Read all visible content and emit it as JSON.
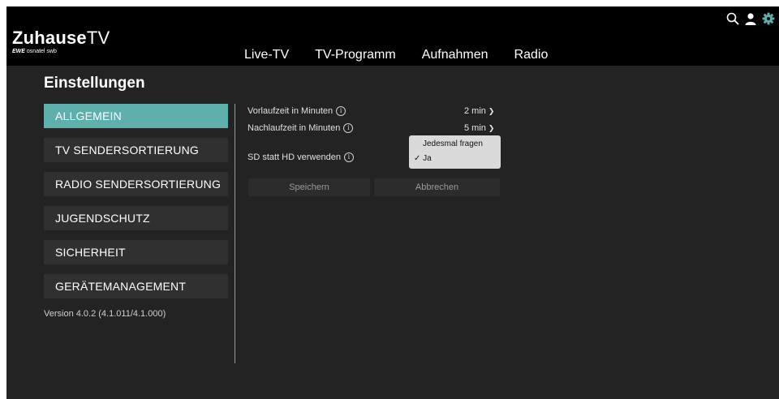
{
  "brand": {
    "title_bold": "Zuhause",
    "title_thin": "TV",
    "sub_ewe": "EWE",
    "sub_rest": "osnatel swb"
  },
  "nav": {
    "items": [
      {
        "label": "Live-TV"
      },
      {
        "label": "TV-Programm"
      },
      {
        "label": "Aufnahmen"
      },
      {
        "label": "Radio"
      }
    ]
  },
  "icons": {
    "search": "search-icon",
    "user": "user-icon",
    "settings": "gear-icon",
    "accent": "#5fb0ac"
  },
  "page": {
    "title": "Einstellungen"
  },
  "sidebar": {
    "items": [
      {
        "label": "ALLGEMEIN",
        "active": true
      },
      {
        "label": "TV SENDERSORTIERUNG",
        "active": false
      },
      {
        "label": "RADIO SENDERSORTIERUNG",
        "active": false
      },
      {
        "label": "JUGENDSCHUTZ",
        "active": false
      },
      {
        "label": "SICHERHEIT",
        "active": false
      },
      {
        "label": "GERÄTEMANAGEMENT",
        "active": false
      }
    ],
    "version": "Version 4.0.2 (4.1.011/4.1.000)"
  },
  "settings": {
    "vorlauf": {
      "label": "Vorlaufzeit in Minuten",
      "value": "2 min"
    },
    "nachlauf": {
      "label": "Nachlaufzeit in Minuten",
      "value": "5 min"
    },
    "sd": {
      "label": "SD statt HD verwenden",
      "options": [
        "Jedesmal fragen",
        "Ja"
      ],
      "selected": "Ja",
      "check": "✓"
    },
    "info_glyph": "i"
  },
  "buttons": {
    "save": "Speichern",
    "cancel": "Abbrechen"
  }
}
